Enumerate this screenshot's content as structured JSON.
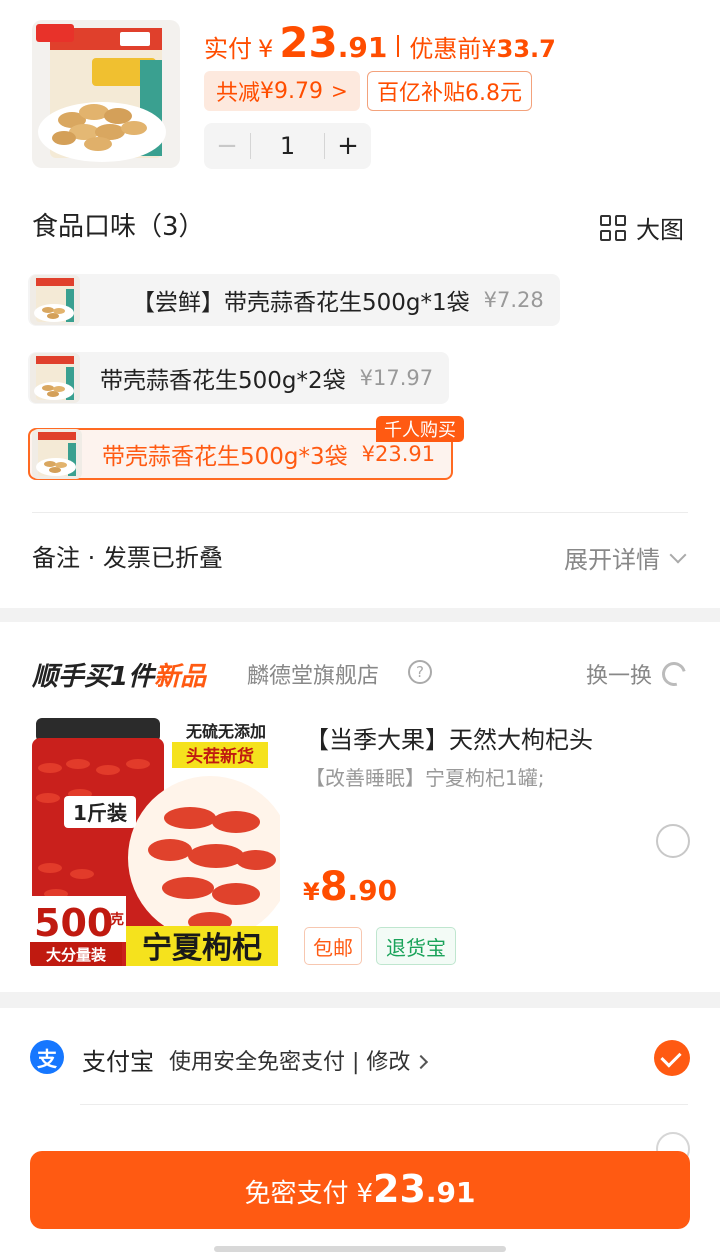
{
  "product": {
    "pay_label": "实付",
    "currency": "¥",
    "pay_int": "23",
    "pay_dec": ".91",
    "orig_label": "优惠前",
    "orig_currency": "¥",
    "orig_price": "33.7",
    "discount_label": "共减",
    "discount_value": "¥9.79",
    "discount_chevron": ">",
    "subsidy": "百亿补贴6.8元",
    "qty": "1",
    "minus": "−",
    "plus": "+"
  },
  "flavor": {
    "title": "食品口味（3）",
    "view_big": "大图",
    "options": [
      {
        "name": "【尝鲜】带壳蒜香花生500g*1袋",
        "price": "¥7.28",
        "selected": false
      },
      {
        "name": "带壳蒜香花生500g*2袋",
        "price": "¥17.97",
        "selected": false
      },
      {
        "name": "带壳蒜香花生500g*3袋",
        "price": "¥23.91",
        "selected": true
      }
    ],
    "hot_tag": "千人购买"
  },
  "remark": {
    "label": "备注 · 发票已折叠",
    "expand": "展开详情"
  },
  "addon": {
    "title_main": "顺手买1件",
    "title_new": "新品",
    "shop": "麟德堂旗舰店",
    "swap": "换一换",
    "item_title": "【当季大果】天然大枸杞头",
    "item_sub": "【改善睡眠】宁夏枸杞1罐;",
    "price_yen": "¥",
    "price_int": "8",
    "price_dec": ".90",
    "tag_free": "包邮",
    "tag_return": "退货宝",
    "img_text": {
      "top1": "无硫无添加",
      "top2": "头茬新货",
      "weight": "1斤装",
      "big": "500",
      "unit": "克",
      "bulk": "大分量装",
      "name": "宁夏枸杞"
    }
  },
  "payment": {
    "icon_char": "支",
    "method": "支付宝",
    "desc": "使用安全免密支付 | 修改",
    "button_label": "免密支付",
    "button_yen": "¥",
    "button_int": "23",
    "button_dec": ".91"
  },
  "colors": {
    "accent": "#ff5a12",
    "price": "#ff4d00",
    "alipay": "#1677ff",
    "return_green": "#1aa35a"
  }
}
